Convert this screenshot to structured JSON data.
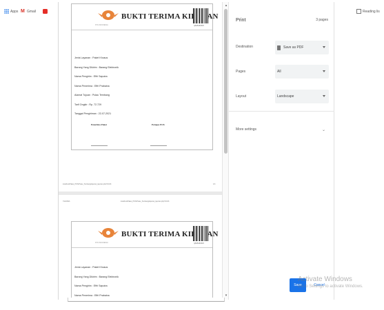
{
  "bookmarks": {
    "apps": "Apps",
    "gmail": "Gmail",
    "reading_list": "Reading lis"
  },
  "preview": {
    "document": {
      "title": "BUKTI TERIMA KIRIMAN",
      "logo_caption": "POS INDONESIA",
      "barcode_number": "rp5x5x5x5x5",
      "fields": [
        "Jenis Layanan : Paket Khusus",
        "Barang Yang Dikirim : Barang Elektronik",
        "Nama Pengirim : Effri Saputra",
        "Nama Penerima : Effri Prabaina",
        "Alamat Tujuan : Pulau Tembang",
        "Tarif Ongkir : Rp. 72.729",
        "Tanggal Pengiriman : 22-07-2021"
      ],
      "signatures": [
        "Penerima Paket",
        "Petugas POS"
      ]
    },
    "page1_footer_left": "localhost/Paket_POS/Pulau_Tembang/laporan_laporan.php?id=43",
    "page1_footer_right": "1/3",
    "page2_header_left": "7/22/2021",
    "page2_header_center": "localhost/Paket_POS/Pulau_Tembang/laporan_laporan.php?id=43"
  },
  "panel": {
    "title": "Print",
    "page_count": "3 pages",
    "destination_label": "Destination",
    "destination_value": "Save as PDF",
    "pages_label": "Pages",
    "pages_value": "All",
    "layout_label": "Layout",
    "layout_value": "Landscape",
    "more_settings": "More settings",
    "save": "Save",
    "cancel": "Cancel"
  },
  "watermark": {
    "line1": "Activate Windows",
    "line2": "Go to Settings to activate Windows."
  }
}
